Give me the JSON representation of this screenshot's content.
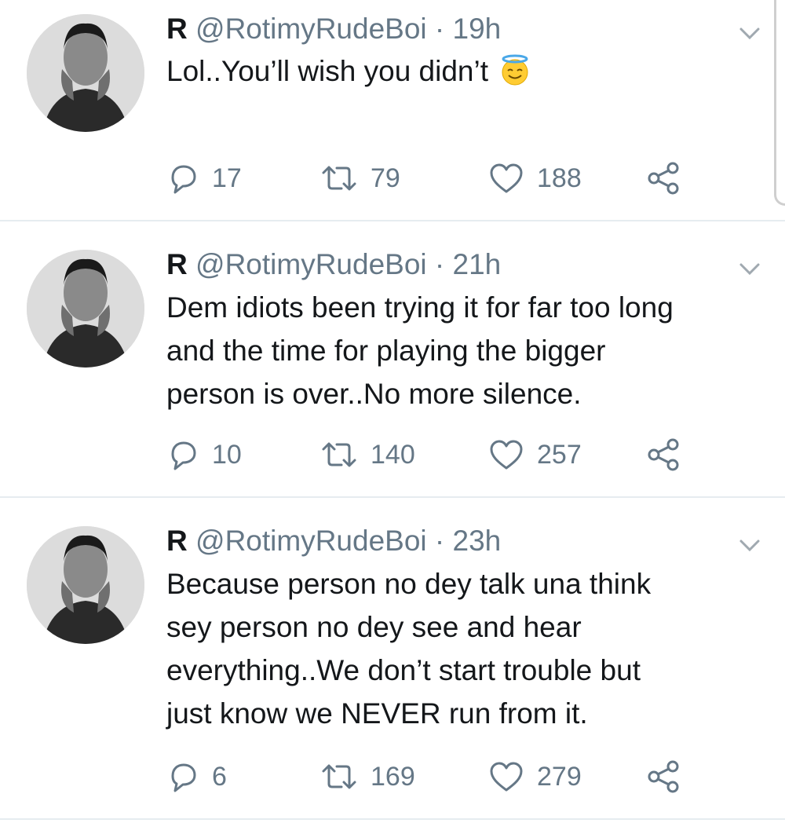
{
  "tweets": [
    {
      "display_name": "R",
      "handle": "@RotimyRudeBoi",
      "separator": "·",
      "time": "19h",
      "text": "Lol..You’ll wish you didn’t",
      "emoji": "smiling-face-with-halo",
      "replies": "17",
      "retweets": "79",
      "likes": "188"
    },
    {
      "display_name": "R",
      "handle": "@RotimyRudeBoi",
      "separator": "·",
      "time": "21h",
      "text_lines": [
        "Dem idiots been trying it for far too long",
        "and the time for playing the bigger",
        "person is over..No more silence."
      ],
      "replies": "10",
      "retweets": "140",
      "likes": "257"
    },
    {
      "display_name": "R",
      "handle": "@RotimyRudeBoi",
      "separator": "·",
      "time": "23h",
      "text_lines": [
        "Because person no dey talk una think",
        "sey person no dey see and hear",
        "everything..We don’t start trouble but",
        "just know we NEVER run from it."
      ],
      "replies": "6",
      "retweets": "169",
      "likes": "279"
    }
  ],
  "icons": {
    "reply": "reply-icon",
    "retweet": "retweet-icon",
    "like": "heart-icon",
    "share": "share-icon",
    "menu": "chevron-down-icon"
  },
  "colors": {
    "text": "#14171a",
    "secondary": "#657786",
    "divider": "#e6ecf0"
  }
}
